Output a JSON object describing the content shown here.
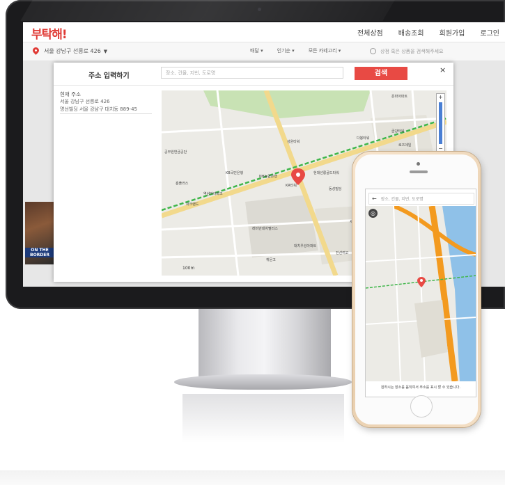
{
  "site": {
    "logo": "부탁해!",
    "nav": [
      "전체상점",
      "배송조회",
      "회원가입",
      "로그인"
    ],
    "address": "서울 강남구 선릉로 426",
    "filters": [
      "배달 ▾",
      "인기순 ▾",
      "모든 카테고리 ▾"
    ],
    "search_placeholder": "상점 혹은 상품을 검색해주세요",
    "thumb_label": "ON THE BORDER"
  },
  "modal": {
    "title": "주소 입력하기",
    "input_placeholder": "장소, 건물, 지번, 도로명",
    "search_button": "검색",
    "close": "×",
    "current_label": "현재 주소",
    "current_line1": "서울 강남구 선릉로 426",
    "current_line2": "명선빌딩 서울 강남구 대치동 889-45"
  },
  "map": {
    "labels": [
      "공무원연금공단",
      "흥플러스",
      "KB국민은행",
      "NH농협은행",
      "KR타워",
      "현대선릉골드타워",
      "동성빌딩",
      "은마아파트",
      "래미안대치팰리스",
      "대치우성아파트",
      "세원빌딩",
      "다봉타워",
      "성원타워",
      "금강타워",
      "로즈데일",
      "파크랜드",
      "역삼아이파크",
      "휘문고",
      "진선여고"
    ],
    "scale": "100m",
    "zoom_in": "+",
    "zoom_out": "−"
  },
  "phone": {
    "search_placeholder": "장소, 건물, 지번, 도로명",
    "back": "←",
    "note": "원하시는 장소를 움직여서 주소를 표시 할 수 있습니다."
  },
  "colors": {
    "brand": "#e03b36",
    "button": "#e84a44"
  }
}
